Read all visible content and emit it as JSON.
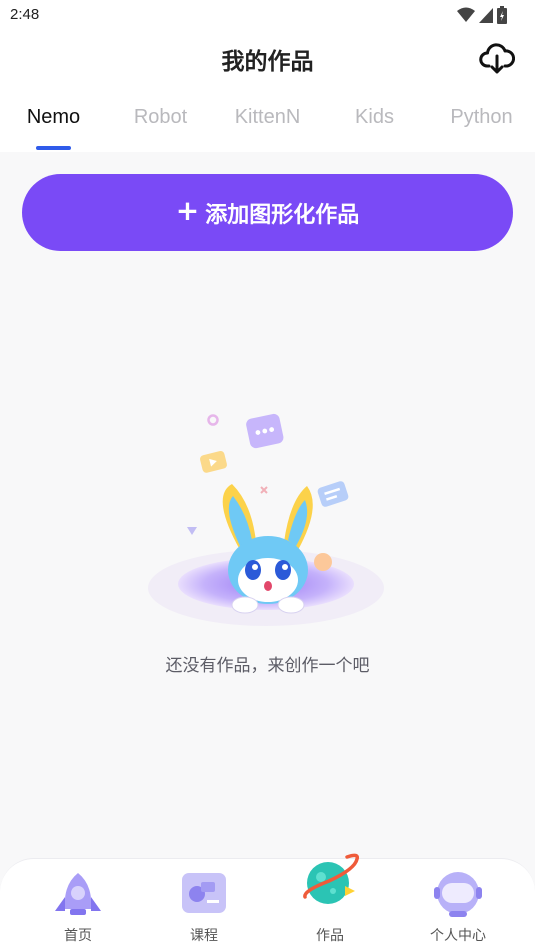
{
  "status": {
    "time": "2:48"
  },
  "header": {
    "title": "我的作品",
    "cloud_icon": "cloud-download-icon"
  },
  "tabs": [
    {
      "label": "Nemo",
      "active": true
    },
    {
      "label": "Robot",
      "active": false
    },
    {
      "label": "KittenN",
      "active": false
    },
    {
      "label": "Kids",
      "active": false
    },
    {
      "label": "Python",
      "active": false
    }
  ],
  "add_button": {
    "label": "添加图形化作品",
    "icon": "plus-icon",
    "color": "#7a4af6"
  },
  "empty_state": {
    "message": "还没有作品，来创作一个吧",
    "illustration": "bunny-in-hole-illustration"
  },
  "bottom_nav": [
    {
      "label": "首页",
      "icon": "rocket-icon"
    },
    {
      "label": "课程",
      "icon": "course-board-icon"
    },
    {
      "label": "作品",
      "icon": "planet-icon",
      "active": true
    },
    {
      "label": "个人中心",
      "icon": "astronaut-helmet-icon"
    }
  ],
  "colors": {
    "accent": "#7a4af6",
    "tab_indicator": "#2f5bea",
    "background": "#f8f8f9"
  }
}
